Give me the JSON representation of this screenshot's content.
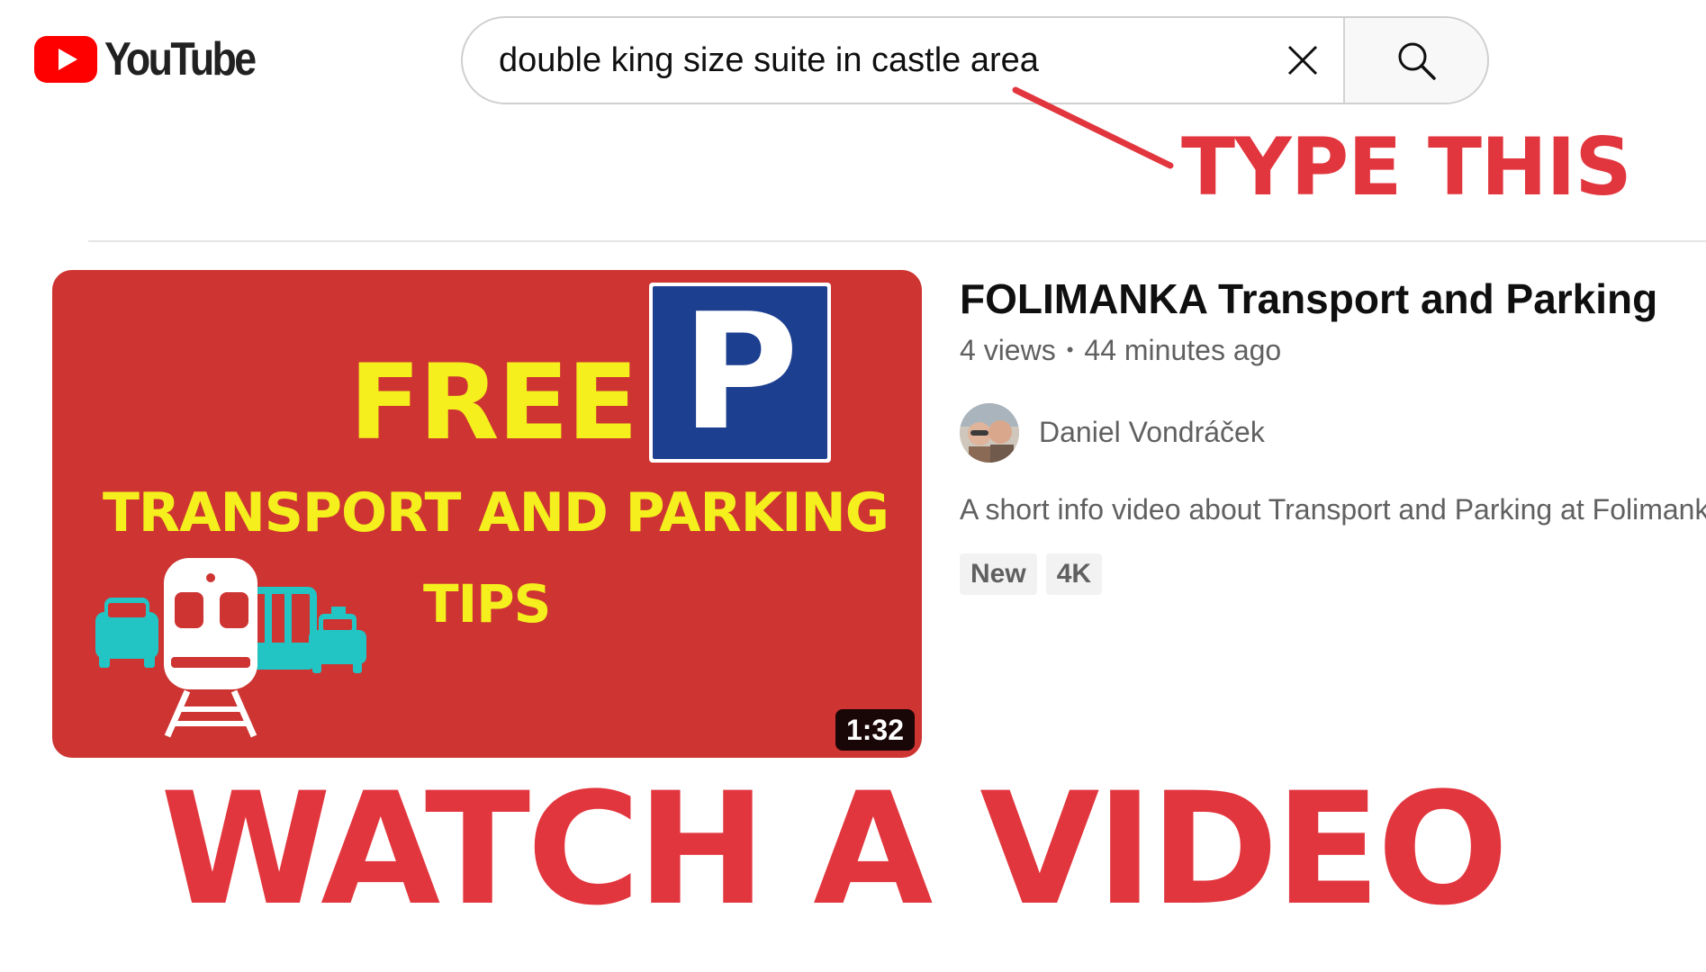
{
  "logo": {
    "text": "YouTube",
    "brand_color": "#ff0000"
  },
  "search": {
    "value": "double king size suite in castle area",
    "clear_icon": "close-icon",
    "search_icon": "search-icon"
  },
  "annotations": {
    "type_this": "TYPE THIS",
    "watch_video": "WATCH A VIDEO",
    "color": "#e2363e"
  },
  "video": {
    "thumbnail": {
      "headline": "FREE",
      "sign_letter": "P",
      "subtitle": "TRANSPORT AND PARKING",
      "tips": "TIPS",
      "background": "#cd3432",
      "text_color": "#f4ef1d",
      "sign_color": "#1d3f8f",
      "vehicles_color": "#22c4c4"
    },
    "duration": "1:32",
    "title": "FOLIMANKA Transport and Parking",
    "views": "4 views",
    "separator": "•",
    "age": "44 minutes ago",
    "channel": "Daniel Vondráček",
    "description": "A short info video about Transport and Parking at Folimanka",
    "badges": [
      "New",
      "4K"
    ]
  }
}
